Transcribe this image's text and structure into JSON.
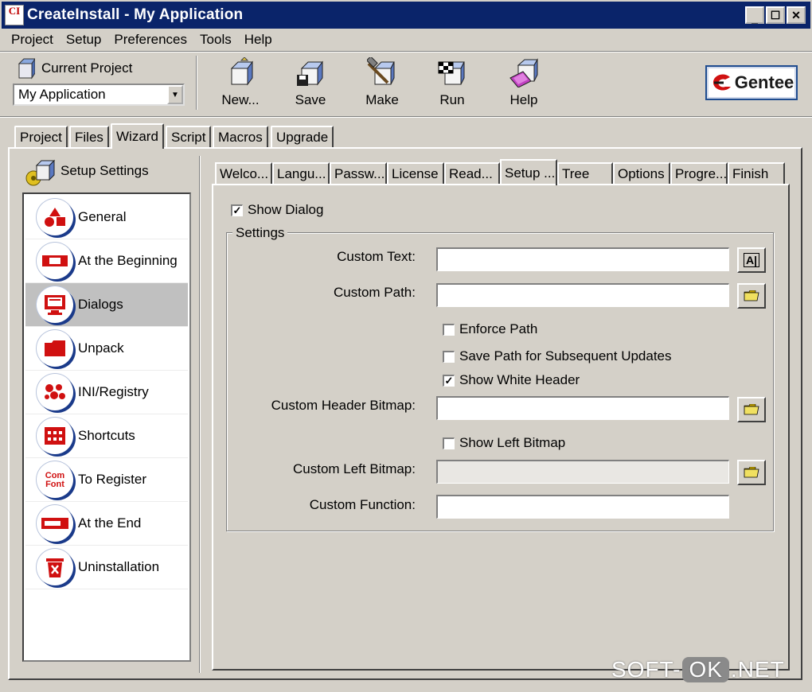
{
  "window": {
    "title": "CreateInstall - My Application",
    "app_icon": "CI"
  },
  "menu": [
    "Project",
    "Setup",
    "Preferences",
    "Tools",
    "Help"
  ],
  "toolbar": {
    "current_project_label": "Current Project",
    "current_project_value": "My Application",
    "buttons": [
      {
        "label": "New...",
        "icon": "new-icon"
      },
      {
        "label": "Save",
        "icon": "save-icon"
      },
      {
        "label": "Make",
        "icon": "make-icon"
      },
      {
        "label": "Run",
        "icon": "run-icon"
      },
      {
        "label": "Help",
        "icon": "help-icon"
      }
    ],
    "logo_text": "Gentee"
  },
  "main_tabs": [
    "Project",
    "Files",
    "Wizard",
    "Script",
    "Macros",
    "Upgrade"
  ],
  "main_tab_active": "Wizard",
  "sidebar": {
    "title": "Setup Settings",
    "items": [
      {
        "label": "General",
        "icon": "shapes-icon"
      },
      {
        "label": "At the Beginning",
        "icon": "banner-icon"
      },
      {
        "label": "Dialogs",
        "icon": "monitor-icon"
      },
      {
        "label": "Unpack",
        "icon": "folder-icon"
      },
      {
        "label": "INI/Registry",
        "icon": "registry-icon"
      },
      {
        "label": "Shortcuts",
        "icon": "shortcuts-icon"
      },
      {
        "label": "To Register",
        "icon": "com-font-icon"
      },
      {
        "label": "At the End",
        "icon": "progress-icon"
      },
      {
        "label": "Uninstallation",
        "icon": "trash-icon"
      }
    ],
    "selected": "Dialogs"
  },
  "sub_tabs": [
    "Welco...",
    "Langu...",
    "Passw...",
    "License",
    "Read...",
    "Setup ...",
    "Tree",
    "Options",
    "Progre...",
    "Finish"
  ],
  "sub_tab_active": "Setup ...",
  "form": {
    "show_dialog": {
      "label": "Show Dialog",
      "checked": true
    },
    "group_label": "Settings",
    "custom_text": {
      "label": "Custom Text:",
      "value": ""
    },
    "custom_path": {
      "label": "Custom Path:",
      "value": ""
    },
    "enforce_path": {
      "label": "Enforce Path",
      "checked": false
    },
    "save_path": {
      "label": "Save Path for Subsequent Updates",
      "checked": false
    },
    "show_white_header": {
      "label": "Show White Header",
      "checked": true
    },
    "custom_header_bitmap": {
      "label": "Custom Header Bitmap:",
      "value": ""
    },
    "show_left_bitmap": {
      "label": "Show Left Bitmap",
      "checked": false
    },
    "custom_left_bitmap": {
      "label": "Custom Left Bitmap:",
      "value": ""
    },
    "custom_function": {
      "label": "Custom Function:",
      "value": ""
    },
    "text_button": "A|"
  },
  "watermark": {
    "pre": "SOFT-",
    "mid": "OK",
    "post": ".NET"
  },
  "colors": {
    "titlebar": "#0a246a",
    "face": "#d4d0c8",
    "icon_red": "#d01010",
    "icon_blue": "#1a3a8a"
  }
}
